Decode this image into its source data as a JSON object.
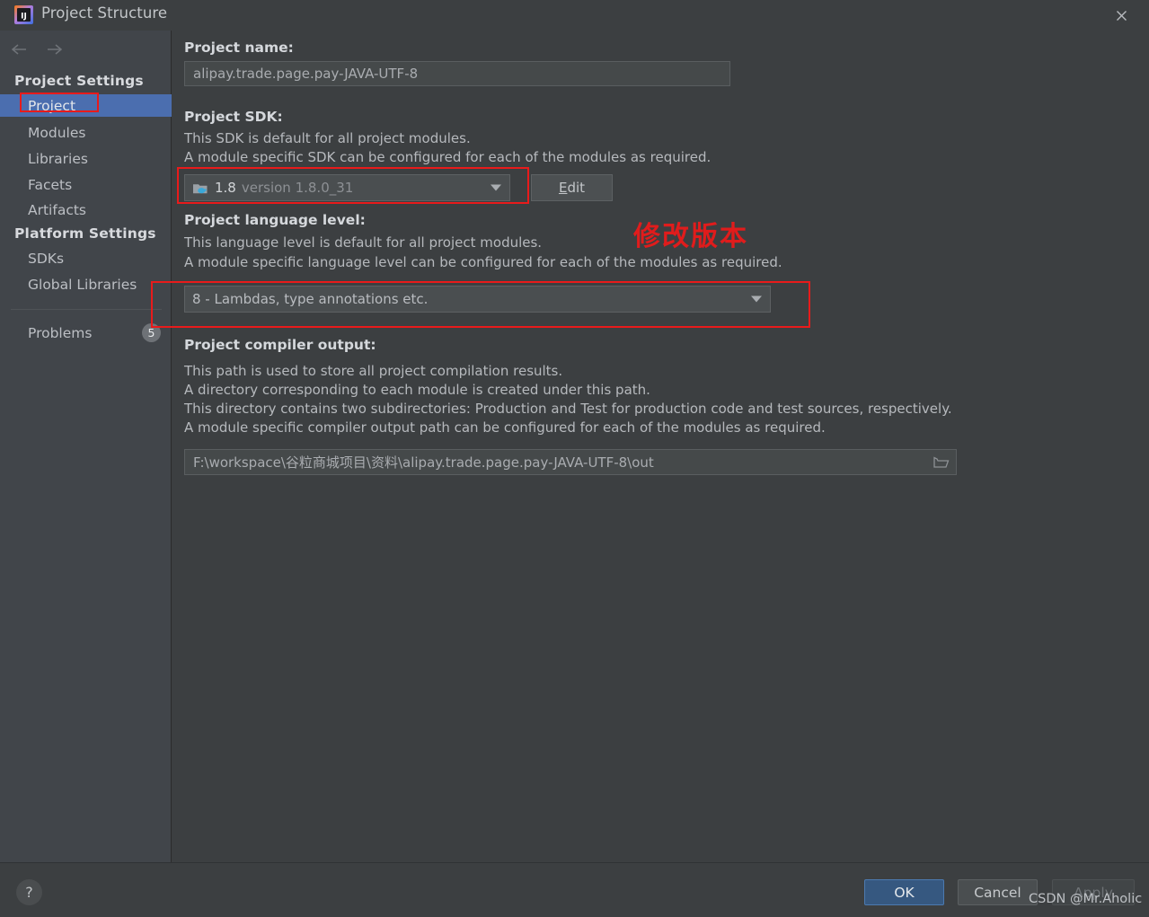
{
  "window": {
    "title": "Project Structure",
    "app_icon": "intellij-idea-logo",
    "close_icon": "close-icon"
  },
  "sidebar": {
    "back_icon": "arrow-left-icon",
    "forward_icon": "arrow-right-icon",
    "groups": [
      {
        "label": "Project Settings"
      },
      {
        "label": "Platform Settings"
      }
    ],
    "items": [
      {
        "label": "Project",
        "selected": true
      },
      {
        "label": "Modules",
        "selected": false
      },
      {
        "label": "Libraries",
        "selected": false
      },
      {
        "label": "Facets",
        "selected": false
      },
      {
        "label": "Artifacts",
        "selected": false
      },
      {
        "label": "SDKs",
        "selected": false
      },
      {
        "label": "Global Libraries",
        "selected": false
      },
      {
        "label": "Problems",
        "selected": false
      }
    ],
    "problems_badge": "5"
  },
  "main": {
    "project_name": {
      "label": "Project name:",
      "value": "alipay.trade.page.pay-JAVA-UTF-8"
    },
    "project_sdk": {
      "label": "Project SDK:",
      "desc_line1": "This SDK is default for all project modules.",
      "desc_line2": "A module specific SDK can be configured for each of the modules as required.",
      "icon": "java-sdk-folder-icon",
      "value_name": "1.8",
      "value_version": "version 1.8.0_31",
      "dropdown_icon": "chevron-down-icon",
      "edit_button": "Edit",
      "edit_mnemonic": "E"
    },
    "language_level": {
      "label": "Project language level:",
      "desc_line1": "This language level is default for all project modules.",
      "desc_line2": "A module specific language level can be configured for each of the modules as required.",
      "value": "8 - Lambdas, type annotations etc.",
      "dropdown_icon": "chevron-down-icon"
    },
    "compiler_output": {
      "label": "Project compiler output:",
      "desc_line1": "This path is used to store all project compilation results.",
      "desc_line2": "A directory corresponding to each module is created under this path.",
      "desc_line3": "This directory contains two subdirectories: Production and Test for production code and test sources, respectively.",
      "desc_line4": "A module specific compiler output path can be configured for each of the modules as required.",
      "value": "F:\\workspace\\谷粒商城项目\\资料\\alipay.trade.page.pay-JAVA-UTF-8\\out",
      "browse_icon": "folder-browse-icon"
    }
  },
  "annotations": {
    "note_cn": "修改版本",
    "color": "#e81b1b"
  },
  "footer": {
    "help_icon": "question-mark-icon",
    "ok": "OK",
    "cancel": "Cancel",
    "apply": "Apply",
    "watermark": "CSDN @Mr.Aholic"
  },
  "colors": {
    "selection_blue": "#4b6eaf",
    "ok_blue": "#365880",
    "annotation_red": "#e81b1b",
    "window_bg": "#3c3f41",
    "sidebar_bg": "#41454a"
  }
}
